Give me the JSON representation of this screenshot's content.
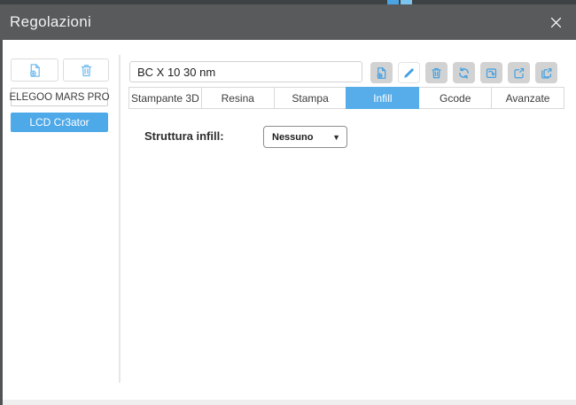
{
  "titlebar": {
    "title": "Regolazioni"
  },
  "sidebar": {
    "add_button_icon": "file-plus-icon",
    "delete_button_icon": "trash-icon",
    "profiles": [
      {
        "label": "ELEGOO MARS PRO",
        "active": false
      },
      {
        "label": "LCD Cr3ator",
        "active": true
      }
    ]
  },
  "profile_bar": {
    "name_value": "BC X 10 30 nm",
    "buttons": [
      {
        "icon": "file-plus-icon",
        "enabled": false
      },
      {
        "icon": "pencil-icon",
        "enabled": true
      },
      {
        "icon": "trash-icon",
        "enabled": false
      },
      {
        "icon": "refresh-icon",
        "enabled": false
      },
      {
        "icon": "import-icon",
        "enabled": false
      },
      {
        "icon": "export-icon",
        "enabled": false
      },
      {
        "icon": "export-all-icon",
        "enabled": false
      }
    ]
  },
  "tabs": [
    {
      "label": "Stampante 3D",
      "active": false
    },
    {
      "label": "Resina",
      "active": false
    },
    {
      "label": "Stampa",
      "active": false
    },
    {
      "label": "Infill",
      "active": true
    },
    {
      "label": "Gcode",
      "active": false
    },
    {
      "label": "Avanzate",
      "active": false
    }
  ],
  "infill_panel": {
    "structure_label": "Struttura infill:",
    "structure_value": "Nessuno",
    "dropdown_arrow_glyph": "▼"
  },
  "colors": {
    "accent_blue": "#57ade9",
    "icon_blue": "#42a0e2",
    "sidebar_icon_blue": "#74bcee",
    "titlebar_gray": "#595a5b",
    "disabled_button_gray": "#d2d2d2"
  }
}
